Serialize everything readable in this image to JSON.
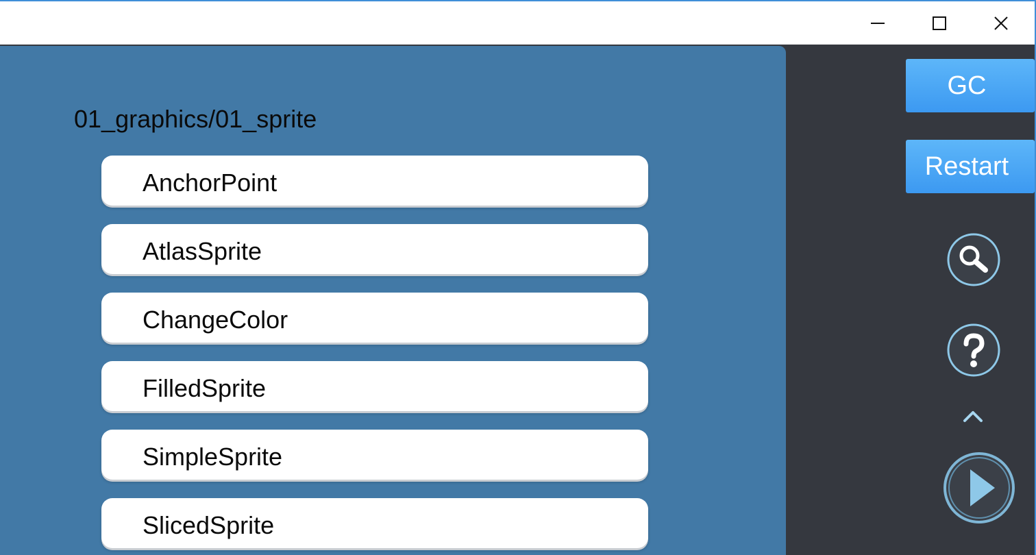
{
  "window": {
    "controls": {
      "minimize_icon": "minimize-icon",
      "maximize_icon": "maximize-icon",
      "close_icon": "close-icon"
    }
  },
  "main": {
    "path": "01_graphics/01_sprite",
    "items": [
      {
        "label": "AnchorPoint"
      },
      {
        "label": "AtlasSprite"
      },
      {
        "label": "ChangeColor"
      },
      {
        "label": "FilledSprite"
      },
      {
        "label": "SimpleSprite"
      },
      {
        "label": "SlicedSprite"
      }
    ]
  },
  "sidebar": {
    "gc_label": "GC",
    "restart_label": "Restart",
    "icons": [
      "search-icon",
      "help-icon",
      "chevron-up-icon",
      "play-icon"
    ]
  },
  "colors": {
    "panel_blue": "#4279a6",
    "sidebar_dark": "#35383f",
    "button_blue": "#4aa7f5",
    "icon_outline": "#8ec8e8",
    "window_border": "#3f8fd8"
  }
}
